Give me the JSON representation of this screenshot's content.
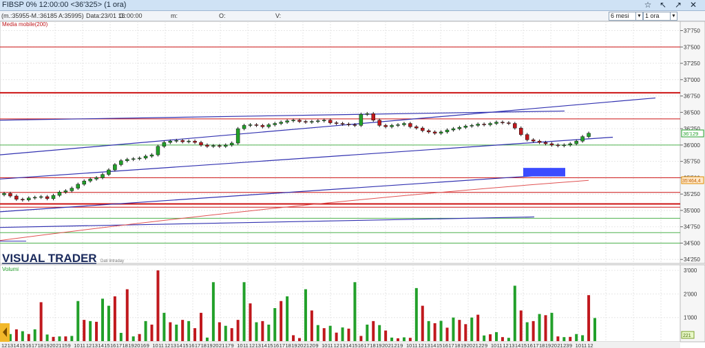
{
  "window": {
    "title": "FIBSP 0% 12:00:00  <36'325>  (1 ora)",
    "buttons": [
      "☆",
      "↖",
      "↗",
      "✕"
    ]
  },
  "infobar": {
    "values": "(m.:35955-M.:36185 A:35995)",
    "date": "Data:23/01 16:00:00",
    "c": "C:",
    "m": "m:",
    "o": "O:",
    "v": "V:",
    "period_label": "6 mesi",
    "interval_label": "1 ora"
  },
  "indicator_label": "Media mobile(200)",
  "brand": "VISUAL TRADER",
  "brand_sub": "Dati Intraday",
  "volume_label": "Volumi",
  "price_badges": {
    "last": "36'129",
    "ma": "35'464,4"
  },
  "volume_badge": "221",
  "colors": {
    "up": "#22a02a",
    "down": "#c0181d",
    "trend": "#3030b0",
    "ma": "#e05050",
    "level_red": "#cc1111",
    "level_green": "#4cb04c",
    "highlight": "#3b4bff"
  },
  "chart_data": [
    {
      "type": "candlestick",
      "title": "",
      "y_ticks": [
        "37'750",
        "37'500",
        "37'250",
        "37'000",
        "36'750",
        "36'500",
        "36'250",
        "36'000",
        "35'750",
        "35'500",
        "35'250",
        "35'000",
        "34'750",
        "34'500",
        "34'250"
      ],
      "ylim": [
        34200,
        37850
      ],
      "x_ticks": [
        "12",
        "13",
        "14",
        "15",
        "16",
        "17",
        "18",
        "19",
        "20",
        "21",
        "15",
        "9",
        "10",
        "11",
        "12",
        "13",
        "14",
        "15",
        "16",
        "17",
        "18",
        "19",
        "20",
        "16",
        "9",
        "10",
        "11",
        "12",
        "13",
        "14",
        "15",
        "16",
        "17",
        "18",
        "19",
        "20",
        "21",
        "17",
        "9",
        "10",
        "11",
        "12",
        "13",
        "14",
        "15",
        "16",
        "17",
        "18",
        "19",
        "20",
        "21",
        "20",
        "9",
        "10",
        "11",
        "12",
        "13",
        "14",
        "15",
        "16",
        "17",
        "18",
        "19",
        "20",
        "21",
        "21",
        "9",
        "10",
        "11",
        "12",
        "13",
        "14",
        "15",
        "16",
        "17",
        "18",
        "19",
        "20",
        "21",
        "22",
        "9",
        "10",
        "11",
        "12",
        "13",
        "14",
        "15",
        "16",
        "17",
        "18",
        "19",
        "20",
        "21",
        "23",
        "9",
        "10",
        "11",
        "12"
      ],
      "horizontal_levels": [
        {
          "value": 37500,
          "color": "red",
          "weight": 1
        },
        {
          "value": 36800,
          "color": "red",
          "weight": 2
        },
        {
          "value": 36400,
          "color": "red",
          "weight": 1
        },
        {
          "value": 36000,
          "color": "green",
          "weight": 1
        },
        {
          "value": 35500,
          "color": "red",
          "weight": 1
        },
        {
          "value": 35275,
          "color": "red",
          "weight": 1
        },
        {
          "value": 35100,
          "color": "red",
          "weight": 2
        },
        {
          "value": 35050,
          "color": "red",
          "weight": 1
        },
        {
          "value": 34880,
          "color": "green",
          "weight": 1
        },
        {
          "value": 34660,
          "color": "green",
          "weight": 1
        },
        {
          "value": 34500,
          "color": "green",
          "weight": 1
        }
      ],
      "closes": [
        35260,
        35220,
        35170,
        35160,
        35190,
        35200,
        35210,
        35180,
        35230,
        35280,
        35300,
        35340,
        35400,
        35450,
        35480,
        35500,
        35550,
        35620,
        35700,
        35760,
        35780,
        35790,
        35800,
        35830,
        35850,
        35980,
        36040,
        36060,
        36070,
        36050,
        36060,
        36040,
        36000,
        35980,
        35990,
        35980,
        36000,
        36030,
        36250,
        36300,
        36310,
        36300,
        36280,
        36310,
        36330,
        36350,
        36370,
        36380,
        36360,
        36350,
        36360,
        36370,
        36380,
        36340,
        36330,
        36320,
        36310,
        36300,
        36470,
        36480,
        36380,
        36300,
        36280,
        36300,
        36310,
        36330,
        36280,
        36260,
        36220,
        36200,
        36180,
        36200,
        36230,
        36250,
        36270,
        36290,
        36300,
        36320,
        36310,
        36330,
        36350,
        36340,
        36330,
        36260,
        36160,
        36080,
        36060,
        36040,
        36020,
        36000,
        35990,
        36000,
        36020,
        36060,
        36129,
        36180
      ]
    },
    {
      "type": "bar",
      "title": "Volumi",
      "y_ticks": [
        "3'000",
        "2'000",
        "1'000"
      ],
      "ylim": [
        0,
        3150
      ],
      "values": [
        560,
        300,
        500,
        420,
        300,
        500,
        1650,
        280,
        180,
        200,
        200,
        220,
        1700,
        900,
        850,
        820,
        1800,
        1500,
        1900,
        350,
        2200,
        200,
        300,
        850,
        700,
        3000,
        1200,
        800,
        700,
        900,
        850,
        550,
        1200,
        150,
        2500,
        800,
        650,
        550,
        900,
        2500,
        1600,
        800,
        850,
        700,
        1400,
        1700,
        1900,
        250,
        130,
        2200,
        1300,
        680,
        550,
        650,
        360,
        580,
        530,
        2500,
        220,
        700,
        850,
        680,
        450,
        150,
        120,
        160,
        140,
        2250,
        1500,
        850,
        760,
        860,
        570,
        1000,
        900,
        720,
        1000,
        1120,
        240,
        290,
        380,
        170,
        140,
        2350,
        1300,
        800,
        850,
        1150,
        1100,
        1200,
        200,
        170,
        180,
        300,
        250,
        1950,
        980
      ],
      "up": [
        false,
        true,
        false,
        true,
        false,
        true,
        false,
        true,
        false,
        true,
        false,
        true,
        true,
        false,
        true,
        false,
        true,
        true,
        false,
        true,
        false,
        true,
        false,
        true,
        false,
        false,
        true,
        false,
        true,
        false,
        true,
        false,
        false,
        true,
        true,
        false,
        true,
        false,
        false,
        true,
        false,
        true,
        false,
        true,
        true,
        false,
        true,
        false,
        false,
        true,
        false,
        true,
        false,
        true,
        false,
        true,
        false,
        true,
        false,
        true,
        false,
        true,
        false,
        true,
        false,
        true,
        false,
        true,
        false,
        true,
        false,
        true,
        false,
        true,
        false,
        false,
        true,
        false,
        true,
        false,
        true,
        false,
        true,
        true,
        false,
        true,
        false,
        true,
        false,
        true,
        false,
        true,
        false,
        true,
        true,
        false,
        true
      ]
    }
  ]
}
